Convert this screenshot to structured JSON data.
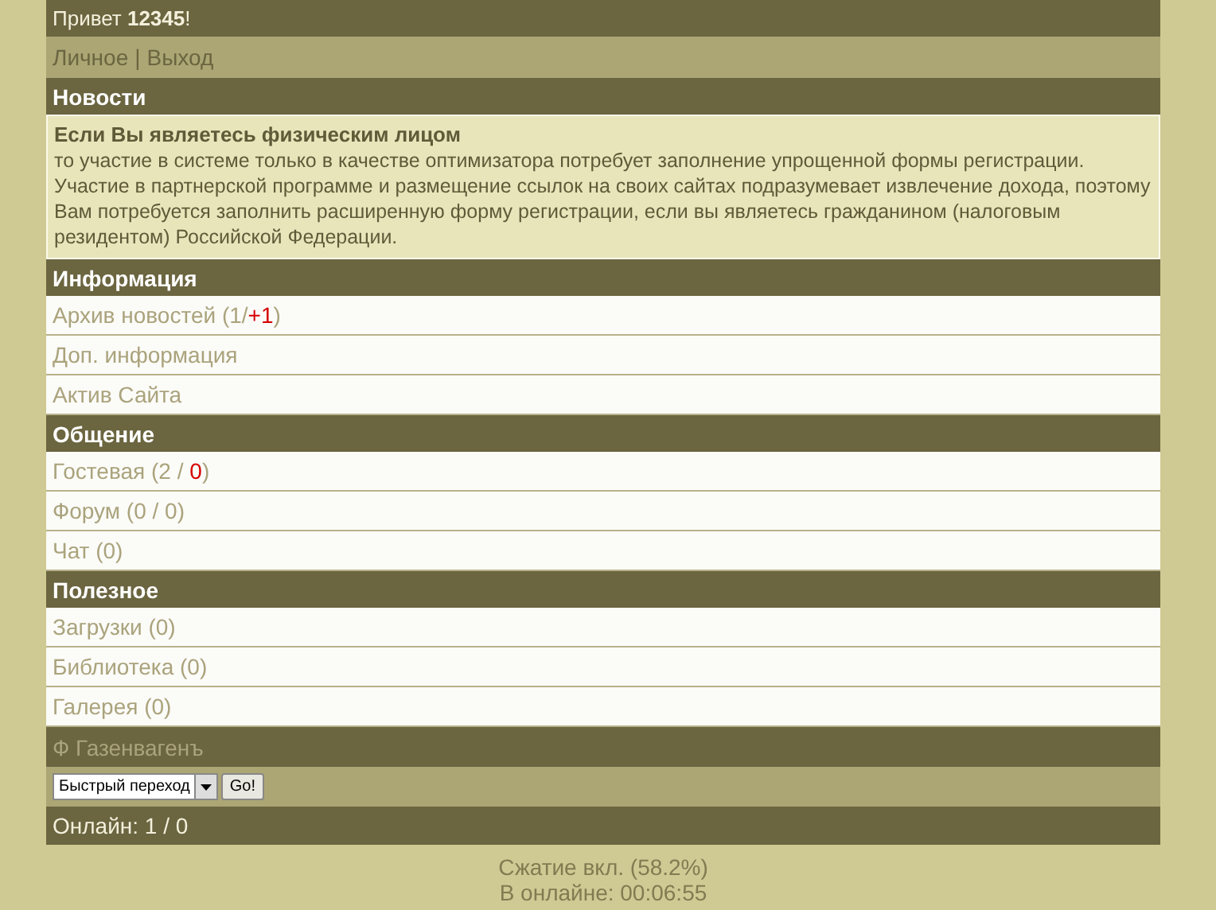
{
  "greeting": "Привет **12345**!",
  "nav": {
    "links": [
      "Личное",
      "Выход"
    ],
    "separator": "|"
  },
  "news": {
    "title": "Новости",
    "headline": "Если Вы являетесь физическим лицом",
    "body": "то участие в системе только в качестве оптимизатора потребует заполнение упрощенной формы регистрации. Участие в партнерской программе и размещение ссылок на своих сайтах подразумевает извлечение дохода, поэтому Вам потребуется заполнить расширенную форму регистрации, если вы являетесь гражданином (налоговым резидентом) Российской Федерации."
  },
  "sections": [
    {
      "title": "Информация",
      "items": [
        {
          "parts": [
            {
              "text": "Архив новостей (1/",
              "kind": "plain"
            },
            {
              "text": "+1",
              "kind": "new"
            },
            {
              "text": ")",
              "kind": "plain"
            }
          ]
        },
        {
          "parts": [
            {
              "text": "Доп. информация",
              "kind": "plain"
            }
          ]
        },
        {
          "parts": [
            {
              "text": "Актив Сайта",
              "kind": "plain"
            }
          ]
        }
      ]
    },
    {
      "title": "Общение",
      "items": [
        {
          "parts": [
            {
              "text": "Гостевая (2 / ",
              "kind": "plain"
            },
            {
              "text": "0",
              "kind": "new"
            },
            {
              "text": ")",
              "kind": "plain"
            }
          ]
        },
        {
          "parts": [
            {
              "text": "Форум (0 / 0)",
              "kind": "plain"
            }
          ]
        },
        {
          "parts": [
            {
              "text": "Чат (0)",
              "kind": "plain"
            }
          ]
        }
      ]
    },
    {
      "title": "Полезное",
      "items": [
        {
          "parts": [
            {
              "text": "Загрузки (0)",
              "kind": "plain"
            }
          ]
        },
        {
          "parts": [
            {
              "text": "Библиотека (0)",
              "kind": "plain"
            }
          ]
        },
        {
          "parts": [
            {
              "text": "Галерея (0)",
              "kind": "plain"
            }
          ]
        }
      ]
    }
  ],
  "signature": "Ф Газенвагенъ",
  "quick_jump": {
    "value": "Быстрый переход",
    "button": "Go!"
  },
  "online": "Онлайн: 1 / 0",
  "footer": [
    "Сжатие вкл. (58.2%)",
    "В онлайне: 00:06:55"
  ]
}
